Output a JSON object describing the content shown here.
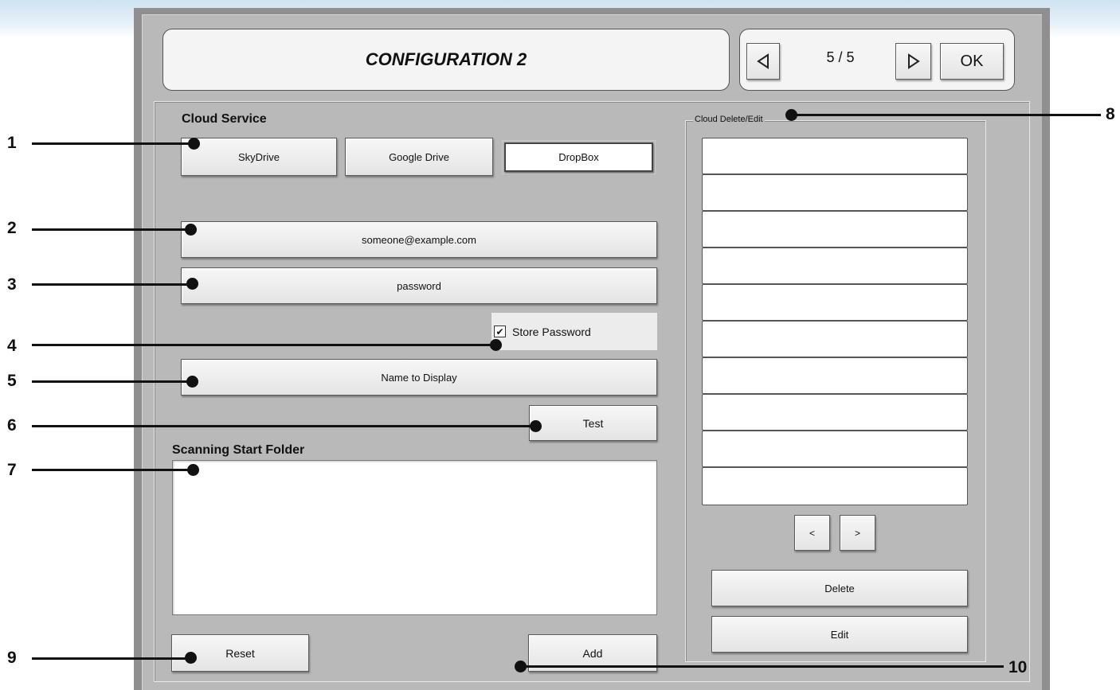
{
  "title": "CONFIGURATION 2",
  "pager": {
    "text": "5 / 5",
    "ok_label": "OK"
  },
  "cloud_service": {
    "label": "Cloud Service",
    "options": [
      "SkyDrive",
      "Google Drive",
      "DropBox"
    ],
    "selected": "DropBox"
  },
  "fields": {
    "email": "someone@example.com",
    "password": "password",
    "store_password_label": "Store Password",
    "store_password_checked": true,
    "name_to_display": "Name to Display",
    "test_label": "Test"
  },
  "scanning": {
    "label": "Scanning Start Folder",
    "value": ""
  },
  "buttons": {
    "reset": "Reset",
    "add": "Add"
  },
  "cloud_list": {
    "legend": "Cloud Delete/Edit",
    "rows": [
      "",
      "",
      "",
      "",
      "",
      "",
      "",
      "",
      "",
      ""
    ],
    "prev": "<",
    "next": ">",
    "delete": "Delete",
    "edit": "Edit"
  },
  "callouts": [
    "1",
    "2",
    "3",
    "4",
    "5",
    "6",
    "7",
    "8",
    "9",
    "10"
  ]
}
